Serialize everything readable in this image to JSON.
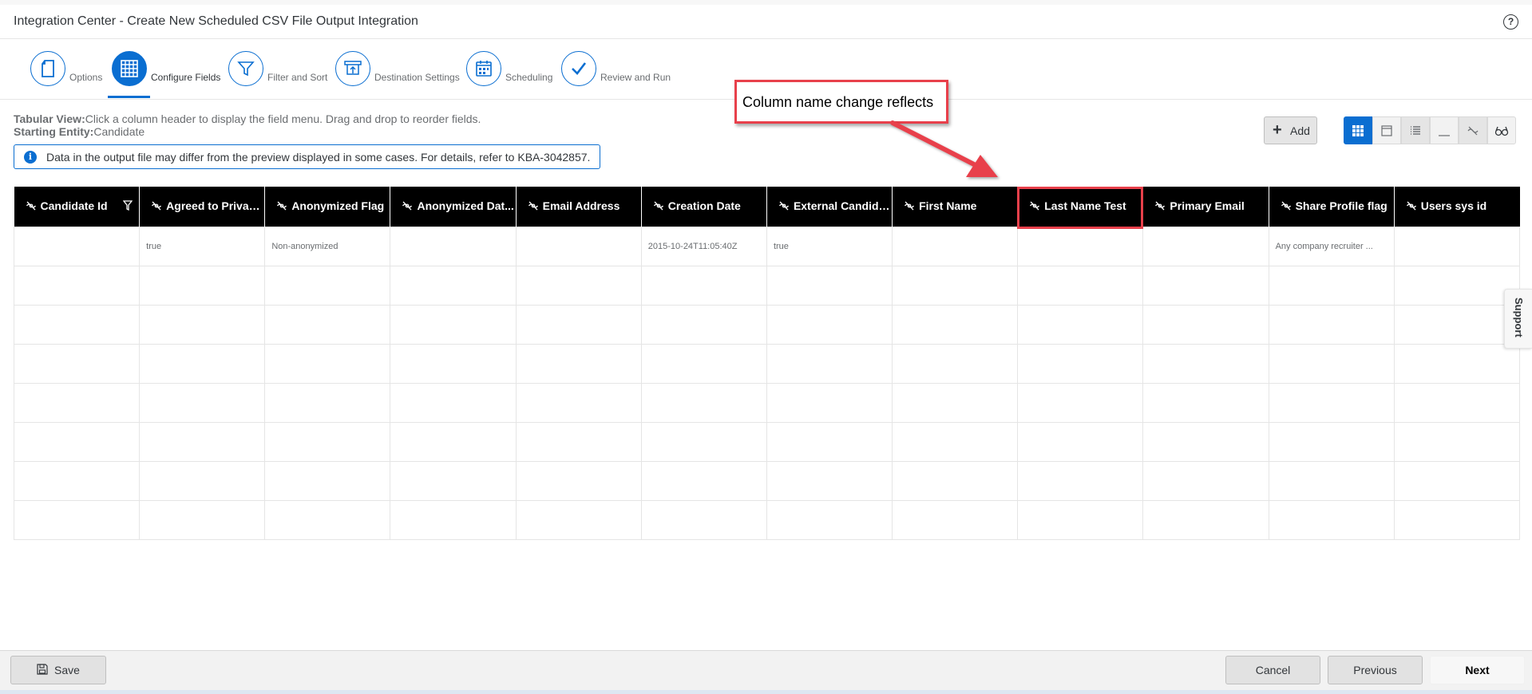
{
  "header": {
    "title": "Integration Center - Create New Scheduled CSV File Output Integration",
    "help_icon": "question-circle-icon"
  },
  "wizard": {
    "steps": [
      {
        "label": "Options",
        "icon": "document-icon",
        "active": false
      },
      {
        "label": "Configure Fields",
        "icon": "table-grid-icon",
        "active": true
      },
      {
        "label": "Filter and Sort",
        "icon": "filter-funnel-icon",
        "active": false
      },
      {
        "label": "Destination Settings",
        "icon": "upload-screen-icon",
        "active": false
      },
      {
        "label": "Scheduling",
        "icon": "calendar-icon",
        "active": false
      },
      {
        "label": "Review and Run",
        "icon": "checkmark-icon",
        "active": false
      }
    ]
  },
  "content": {
    "tabular_view_label": "Tabular View:",
    "tabular_view_text": "Click a column header to display the field menu. Drag and drop to reorder fields.",
    "starting_entity_label": "Starting Entity:",
    "starting_entity_value": "Candidate",
    "notice_text": "Data in the output file may differ from the preview displayed in some cases. For details, refer to KBA-3042857."
  },
  "toolbar": {
    "add_label": "Add",
    "view_buttons": [
      "grid-view-icon",
      "detail-view-icon",
      "list-view-icon",
      "underline-view-icon",
      "hide-icon",
      "preview-glasses-icon"
    ]
  },
  "annotation": {
    "callout_text": "Column name change reflects",
    "color": "#e8404b"
  },
  "table": {
    "columns": [
      "Candidate Id",
      "Agreed to Privacy...",
      "Anonymized Flag",
      "Anonymized Dat...",
      "Email Address",
      "Creation Date",
      "External Candidate",
      "First Name",
      "Last Name Test",
      "Primary Email",
      "Share Profile flag",
      "Users sys id"
    ],
    "rows": [
      [
        "",
        "true",
        "Non-anonymized",
        "",
        "",
        "2015-10-24T11:05:40Z",
        "true",
        "",
        "",
        "",
        "Any company recruiter ...",
        ""
      ],
      [
        "",
        "",
        "",
        "",
        "",
        "",
        "",
        "",
        "",
        "",
        "",
        ""
      ],
      [
        "",
        "",
        "",
        "",
        "",
        "",
        "",
        "",
        "",
        "",
        "",
        ""
      ],
      [
        "",
        "",
        "",
        "",
        "",
        "",
        "",
        "",
        "",
        "",
        "",
        ""
      ],
      [
        "",
        "",
        "",
        "",
        "",
        "",
        "",
        "",
        "",
        "",
        "",
        ""
      ],
      [
        "",
        "",
        "",
        "",
        "",
        "",
        "",
        "",
        "",
        "",
        "",
        ""
      ],
      [
        "",
        "",
        "",
        "",
        "",
        "",
        "",
        "",
        "",
        "",
        "",
        ""
      ],
      [
        "",
        "",
        "",
        "",
        "",
        "",
        "",
        "",
        "",
        "",
        "",
        ""
      ]
    ]
  },
  "support_tab": {
    "label": "Support"
  },
  "footer": {
    "save_label": "Save",
    "cancel_label": "Cancel",
    "previous_label": "Previous",
    "next_label": "Next"
  },
  "colors": {
    "accent": "#0a6ed1",
    "header_bg": "#000000",
    "annotation_red": "#e8404b"
  }
}
